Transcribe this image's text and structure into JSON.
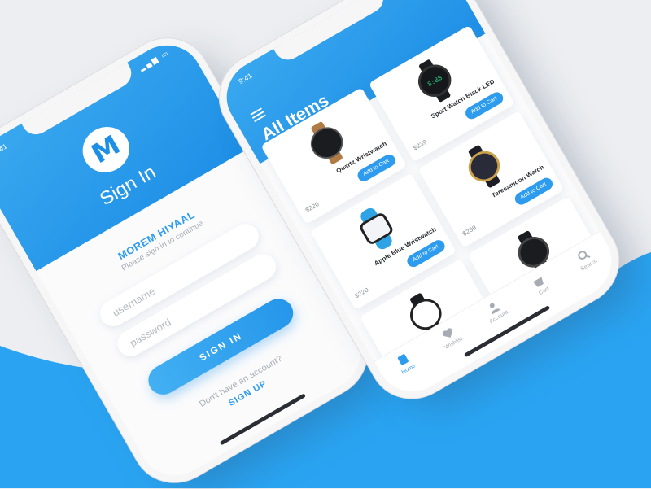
{
  "status": {
    "time": "9:41"
  },
  "signin": {
    "title": "Sign In",
    "user_name": "MOREM HIYAAL",
    "subtitle": "Please sign in to continue",
    "username_placeholder": "username",
    "password_placeholder": "password",
    "signin_button": "SIGN IN",
    "no_account": "Don't have an account?",
    "signup_link": "SIGN UP"
  },
  "shop": {
    "title": "All Items",
    "products": [
      {
        "name": "Quartz Wristwatch",
        "price": "$220",
        "button": "Add to Cart",
        "face": "#1b1c20",
        "strap": "#b07b45"
      },
      {
        "name": "Sport Watch Black LED",
        "price": "$239",
        "button": "Add to Cart",
        "face": "#15171a",
        "strap": "#1b1c20"
      },
      {
        "name": "Apple Blue Wristwatch",
        "price": "$220",
        "button": "Add to Cart",
        "face": "#f2f4f7",
        "strap": "#2ea3e6"
      },
      {
        "name": "Teresamoon Watch",
        "price": "$239",
        "button": "Add to Cart",
        "face": "#2a2b38",
        "strap": "#1c1d27"
      },
      {
        "name": "",
        "price": "",
        "button": "",
        "face": "#ffffff",
        "strap": "#1b1c20"
      },
      {
        "name": "",
        "price": "",
        "button": "",
        "face": "#1b1c20",
        "strap": "#1b1c20"
      }
    ],
    "tabs": [
      {
        "label": "Home",
        "icon": "home-icon",
        "active": true
      },
      {
        "label": "Wishlist",
        "icon": "heart-icon",
        "active": false
      },
      {
        "label": "Account",
        "icon": "user-icon",
        "active": false
      },
      {
        "label": "Cart",
        "icon": "cart-icon",
        "active": false
      },
      {
        "label": "Search",
        "icon": "search-icon",
        "active": false
      }
    ]
  },
  "colors": {
    "accent": "#2d9cee",
    "background": "#eceef1",
    "wave": "#2aa4f2"
  }
}
